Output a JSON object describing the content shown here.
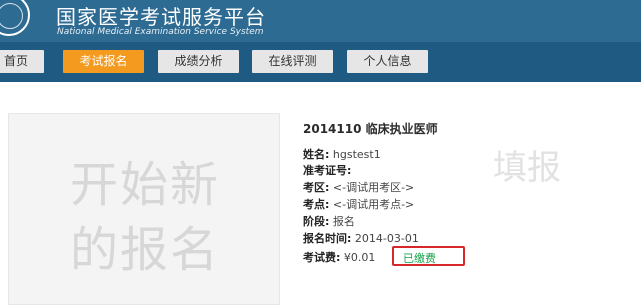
{
  "header": {
    "title_cn": "国家医学考试服务平台",
    "title_en": "National Medical Examination Service System"
  },
  "nav": {
    "items": [
      {
        "label": "首页"
      },
      {
        "label": "考试报名",
        "active": true
      },
      {
        "label": "成绩分析"
      },
      {
        "label": "在线评测"
      },
      {
        "label": "个人信息"
      }
    ]
  },
  "main": {
    "card_text_line1": "开始新",
    "card_text_line2": "的报名",
    "side_text": "填报",
    "exam_title": "2014110 临床执业医师",
    "fields": [
      {
        "key": "姓名:",
        "value": "hgstest1"
      },
      {
        "key": "准考证号:",
        "value": ""
      },
      {
        "key": "考区:",
        "value": "<-调试用考区->"
      },
      {
        "key": "考点:",
        "value": "<-调试用考点->"
      },
      {
        "key": "阶段:",
        "value": "报名"
      },
      {
        "key": "报名时间:",
        "value": "2014-03-01"
      },
      {
        "key": "考试费:",
        "value": "¥0.01"
      }
    ],
    "paid_status": "已缴费"
  },
  "colors": {
    "header_bg": "#2e6b93",
    "nav_bg": "#1f5a83",
    "nav_active": "#f39a1f",
    "paid_text": "#16a34a",
    "highlight_border": "#d7272a"
  }
}
